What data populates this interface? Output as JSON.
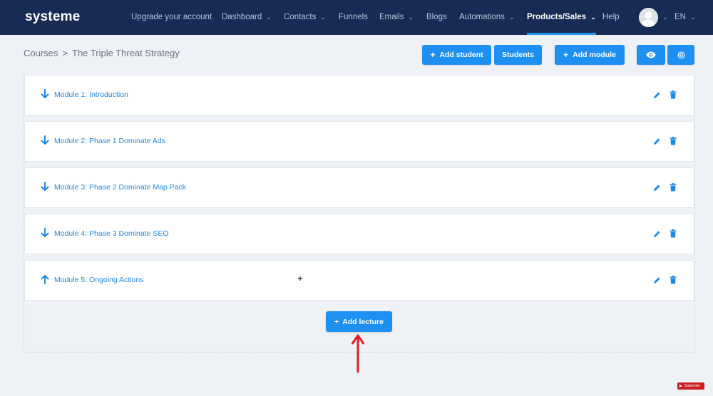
{
  "brand": {
    "logo_text": "systeme",
    "accent_color": "#1e90f2",
    "nav_bg": "#172b55"
  },
  "nav": {
    "upgrade": "Upgrade your account",
    "dashboard": "Dashboard",
    "contacts": "Contacts",
    "funnels": "Funnels",
    "emails": "Emails",
    "blogs": "Blogs",
    "automations": "Automations",
    "products_sales": "Products/Sales",
    "help": "Help",
    "language": "EN",
    "active_item": "Products/Sales"
  },
  "breadcrumb": {
    "parent": "Courses",
    "separator": ">",
    "current": "The Triple Threat Strategy"
  },
  "toolbar": {
    "add_student": "Add student",
    "students": "Students",
    "add_module": "Add module",
    "preview_icon": "eye-icon",
    "settings_icon": "gear-icon"
  },
  "modules": [
    {
      "title": "Module 1: Introduction",
      "state": "collapsed"
    },
    {
      "title": "Module 2: Phase 1 Dominate Ads",
      "state": "collapsed"
    },
    {
      "title": "Module 3: Phase 2 Dominate Map Pack",
      "state": "collapsed"
    },
    {
      "title": "Module 4: Phase 3 Dominate SEO",
      "state": "collapsed"
    },
    {
      "title": "Module 5: Ongoing Actions",
      "state": "expanded"
    }
  ],
  "lecture": {
    "add_label": "Add lecture"
  },
  "overlay": {
    "subscribe_label": "Subscribe",
    "annotation_arrow_color": "#e02020"
  }
}
